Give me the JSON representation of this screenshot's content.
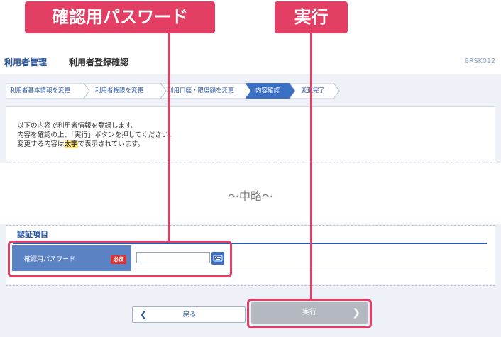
{
  "callouts": {
    "password_tag": "確認用パスワード",
    "execute_tag": "実行"
  },
  "header": {
    "title": "利用者管理",
    "subtitle": "利用者登録確認",
    "screen_code": "BRSK012"
  },
  "steps": [
    {
      "label": "利用者基本情報を変更",
      "active": false
    },
    {
      "label": "利用者権限を変更",
      "active": false
    },
    {
      "label": "利用口座・限度額を変更",
      "active": false
    },
    {
      "label": "内容確認",
      "active": true
    },
    {
      "label": "変更完了",
      "active": false
    }
  ],
  "message": {
    "line1": "以下の内容で利用者情報を登録します。",
    "line2": "内容を確認の上、「実行」ボタンを押してください。",
    "line3_pre": "変更する内容は",
    "line3_highlight": "太字",
    "line3_post": "で表示されています。"
  },
  "omitted_text": "～中略～",
  "auth": {
    "section_title": "認証項目",
    "password_label": "確認用パスワード",
    "required_badge": "必須",
    "password_value": ""
  },
  "buttons": {
    "back_label": "戻る",
    "execute_label": "実行"
  },
  "colors": {
    "accent": "#2d5aa8",
    "callout": "#e33e63",
    "active_step": "#3a6fc3",
    "disabled_button": "#b4b9c1"
  }
}
